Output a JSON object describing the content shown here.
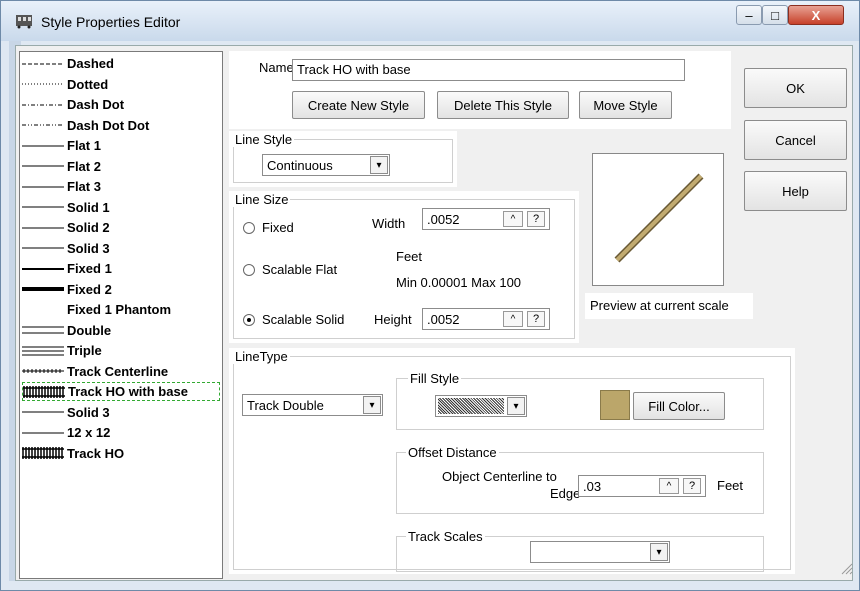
{
  "window": {
    "title": "Style Properties Editor",
    "min_glyph": "–",
    "max_glyph": "□",
    "close_glyph": "X"
  },
  "list": {
    "items": [
      {
        "label": "Dashed",
        "swatch": "dashed"
      },
      {
        "label": "Dotted",
        "swatch": "dotted"
      },
      {
        "label": "Dash Dot",
        "swatch": "dashdot"
      },
      {
        "label": "Dash Dot Dot",
        "swatch": "dashdotdot"
      },
      {
        "label": "Flat 1",
        "swatch": "thin"
      },
      {
        "label": "Flat 2",
        "swatch": "thin"
      },
      {
        "label": "Flat 3",
        "swatch": "thin"
      },
      {
        "label": "Solid 1",
        "swatch": "thin"
      },
      {
        "label": "Solid 2",
        "swatch": "thin"
      },
      {
        "label": "Solid 3",
        "swatch": "thin"
      },
      {
        "label": "Fixed 1",
        "swatch": "medium"
      },
      {
        "label": "Fixed 2",
        "swatch": "thick"
      },
      {
        "label": "Fixed 1 Phantom",
        "swatch": "none"
      },
      {
        "label": "Double",
        "swatch": "double"
      },
      {
        "label": "Triple",
        "swatch": "triple"
      },
      {
        "label": "Track Centerline",
        "swatch": "centerline"
      },
      {
        "label": "Track HO with base",
        "swatch": "track",
        "selected": true
      },
      {
        "label": "Solid 3",
        "swatch": "thin"
      },
      {
        "label": "12 x 12",
        "swatch": "thin"
      },
      {
        "label": "Track HO",
        "swatch": "track"
      }
    ]
  },
  "name": {
    "label": "Name:",
    "value": "Track HO with base"
  },
  "buttons": {
    "create": "Create New Style",
    "delete": "Delete This Style",
    "move": "Move Style",
    "ok": "OK",
    "cancel": "Cancel",
    "help": "Help"
  },
  "line_style": {
    "title": "Line Style",
    "value": "Continuous"
  },
  "line_size": {
    "title": "Line Size",
    "fixed": "Fixed",
    "scalable_flat": "Scalable Flat",
    "scalable_solid": "Scalable Solid",
    "width_label": "Width",
    "width_value": ".0052",
    "height_label": "Height",
    "height_value": ".0052",
    "units": "Feet",
    "minmax": "Min 0.00001  Max 100",
    "selected": "scalable_solid"
  },
  "preview": {
    "caption": "Preview at current scale"
  },
  "linetype": {
    "title": "LineType",
    "value": "Track Double",
    "fill_style_title": "Fill Style",
    "fill_color_label": "Fill Color...",
    "fill_color": "#bba66a",
    "offset_title": "Offset Distance",
    "offset_label_1": "Object Centerline to",
    "offset_label_2": "Edge",
    "offset_value": ".03",
    "offset_units": "Feet",
    "track_scales_title": "Track Scales",
    "track_scales_value": ""
  },
  "spin": {
    "up": "^",
    "help": "?"
  },
  "combo_arrow": "▾"
}
